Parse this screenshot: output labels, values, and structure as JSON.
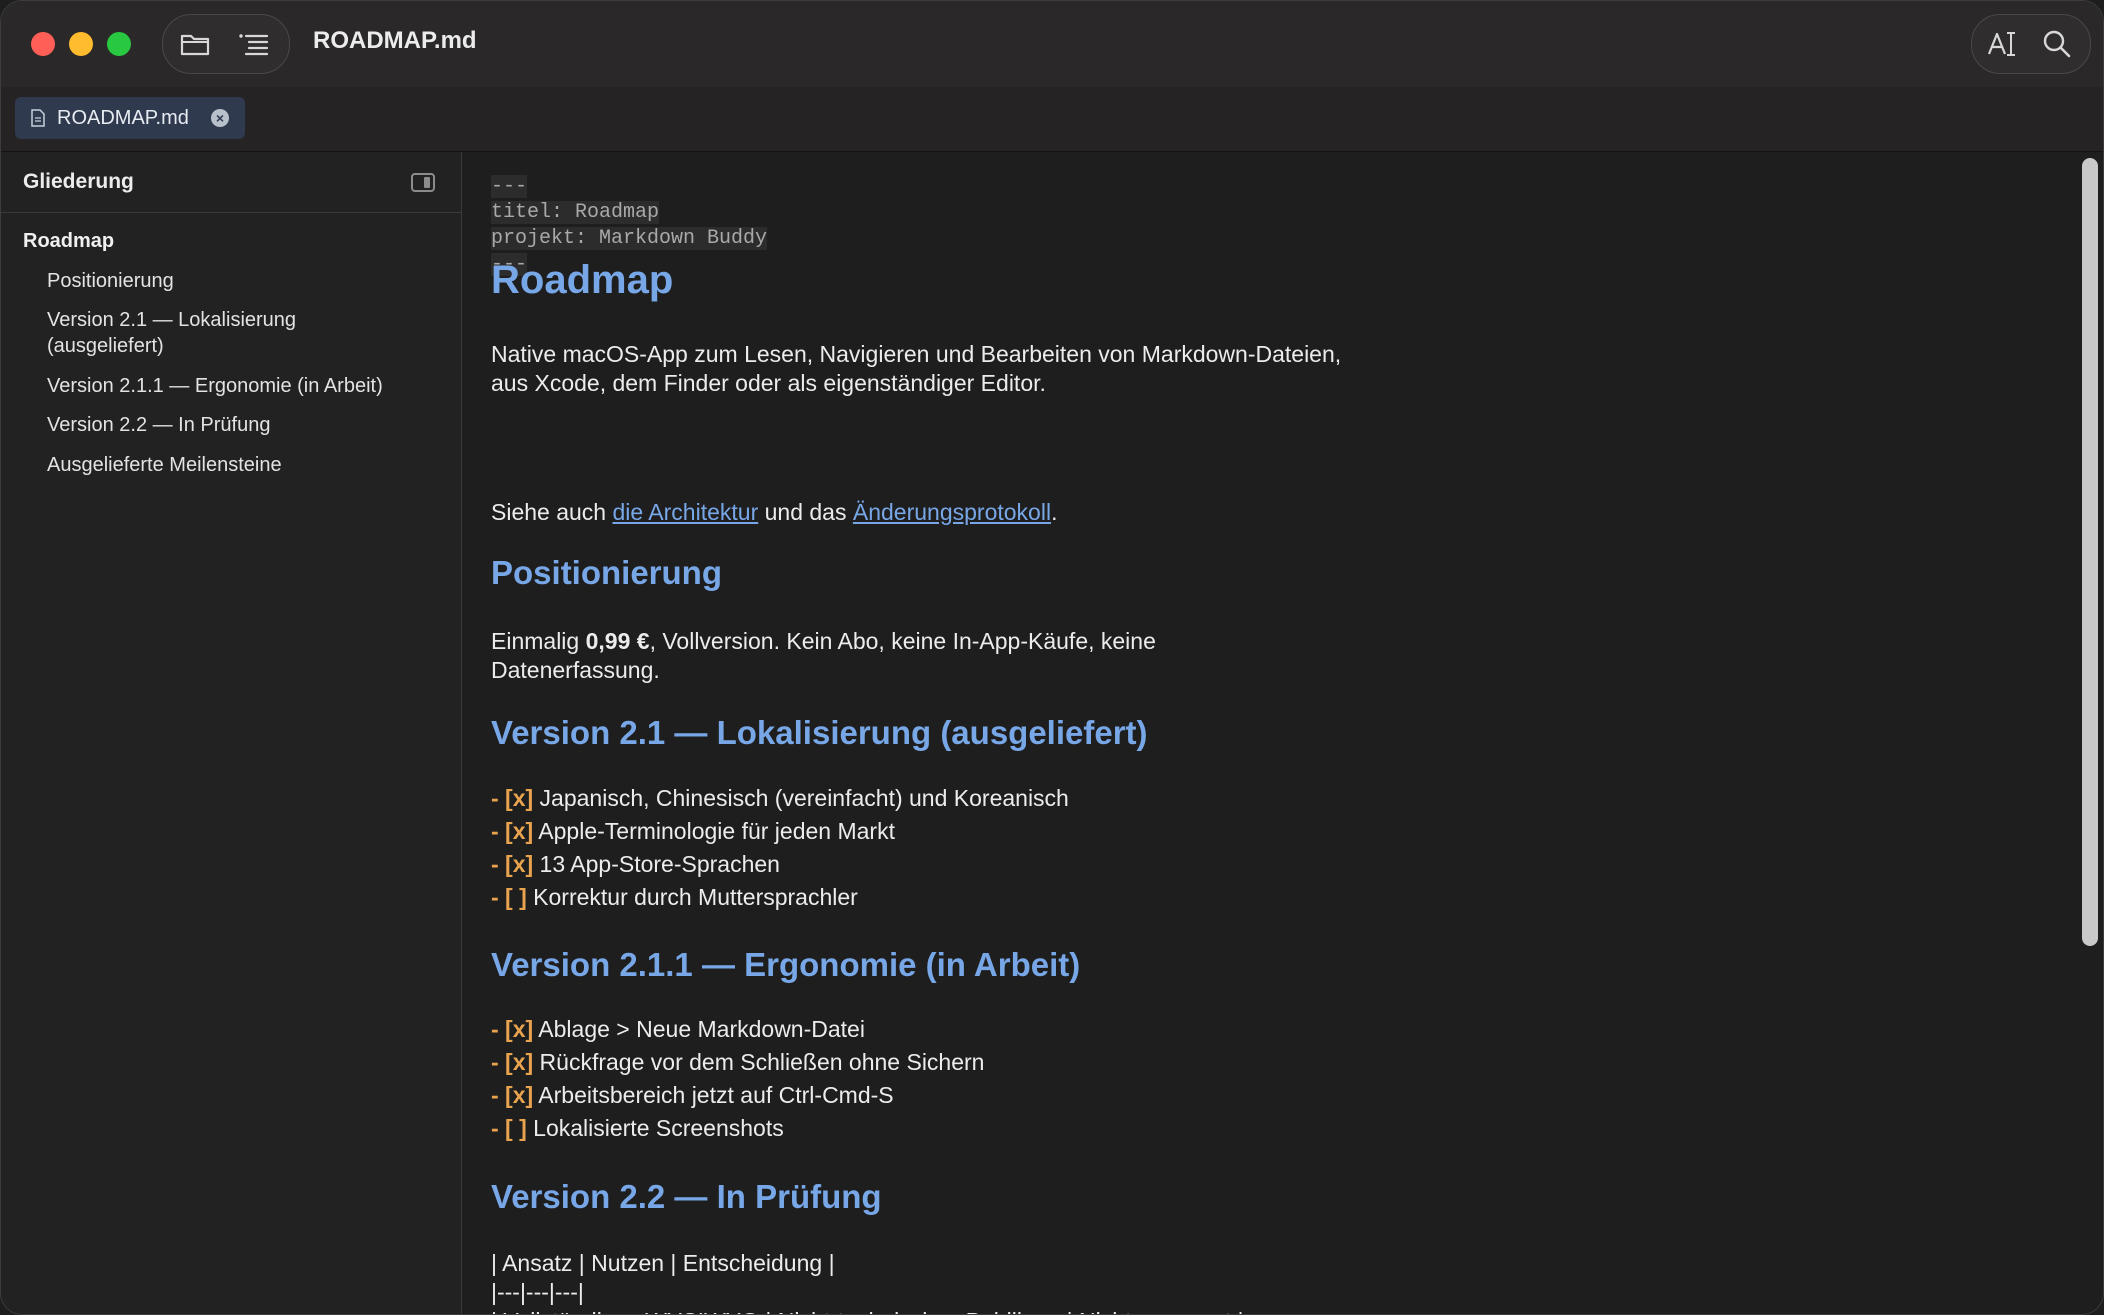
{
  "window": {
    "title": "ROADMAP.md"
  },
  "tab": {
    "label": "ROADMAP.md",
    "close": "×"
  },
  "sidebar": {
    "title": "Gliederung",
    "root": "Roadmap",
    "items": [
      {
        "label": "Positionierung"
      },
      {
        "label": "Version 2.1 — Lokalisierung",
        "label2": "(ausgeliefert)"
      },
      {
        "label": "Version 2.1.1 — Ergonomie (in Arbeit)"
      },
      {
        "label": "Version 2.2 — In Prüfung"
      },
      {
        "label": "Ausgelieferte Meilensteine"
      }
    ]
  },
  "doc": {
    "frontmatter": [
      "---",
      "titel: Roadmap",
      "projekt: Markdown Buddy",
      "---"
    ],
    "h1": "Roadmap",
    "intro1": "Native macOS-App zum Lesen, Navigieren und Bearbeiten von Markdown-Dateien,",
    "intro2": "aus Xcode, dem Finder oder als eigenständiger Editor.",
    "see_also": {
      "prefix": "Siehe auch ",
      "link1": "die Architektur",
      "middle": " und das ",
      "link2": "Änderungsprotokoll",
      "suffix": "."
    },
    "sec_positioning": {
      "title": "Positionierung",
      "line1_prefix": "Einmalig ",
      "line1_bold": "0,99 €",
      "line1_suffix": ", Vollversion. Kein Abo, keine In-App-Käufe, keine",
      "line2": "Datenerfassung."
    },
    "sec_21": {
      "title": "Version 2.1 — Lokalisierung (ausgeliefert)",
      "items": [
        {
          "marker": "- [x]",
          "text": " Japanisch, Chinesisch (vereinfacht) und Koreanisch"
        },
        {
          "marker": "- [x]",
          "text": " Apple-Terminologie für jeden Markt"
        },
        {
          "marker": "- [x]",
          "text": " 13 App-Store-Sprachen"
        },
        {
          "marker": "- [ ]",
          "text": " Korrektur durch Muttersprachler"
        }
      ]
    },
    "sec_211": {
      "title": "Version 2.1.1 — Ergonomie (in Arbeit)",
      "items": [
        {
          "marker": "- [x]",
          "text": " Ablage > Neue Markdown-Datei"
        },
        {
          "marker": "- [x]",
          "text": " Rückfrage vor dem Schließen ohne Sichern"
        },
        {
          "marker": "- [x]",
          "text": " Arbeitsbereich jetzt auf Ctrl-Cmd-S"
        },
        {
          "marker": "- [ ]",
          "text": " Lokalisierte Screenshots"
        }
      ]
    },
    "sec_22": {
      "title": "Version 2.2 — In Prüfung",
      "table_lines": [
        "| Ansatz | Nutzen | Entscheidung |",
        "|---|---|---|",
        "| Vollständiges WYSIWYG | Nicht-technisches Publikum | Nicht zugesagt |"
      ]
    }
  },
  "colors": {
    "heading": "#78a7e8",
    "task_marker": "#e8a34f",
    "background": "#1e1e1e"
  }
}
